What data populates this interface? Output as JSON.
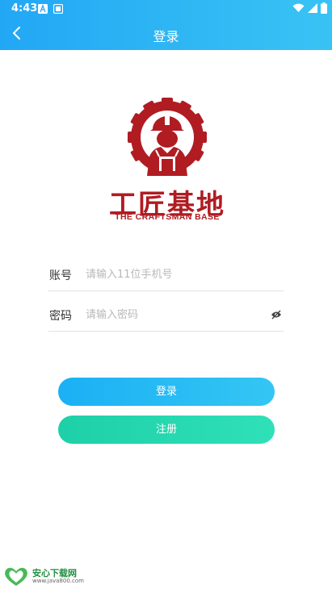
{
  "status_bar": {
    "time": "4:43"
  },
  "nav": {
    "title": "登录"
  },
  "logo": {
    "name_cn": "工匠基地",
    "name_en": "THE CRAFTSMAN BASE"
  },
  "form": {
    "account": {
      "label": "账号",
      "placeholder": "请输入11位手机号",
      "value": ""
    },
    "password": {
      "label": "密码",
      "placeholder": "请输入密码",
      "value": ""
    }
  },
  "buttons": {
    "login": "登录",
    "register": "注册"
  },
  "watermark": {
    "name": "安心下载网",
    "url": "www.java800.com"
  },
  "colors": {
    "header": "#22a7f5",
    "brand_red": "#b01c22",
    "login_btn": "#1bb0f4",
    "register_btn": "#1ed0a7"
  },
  "icons": [
    "notification-a-icon",
    "notification-image-icon",
    "wifi-icon",
    "signal-icon",
    "battery-icon",
    "back-arrow-icon",
    "eye-off-icon"
  ]
}
